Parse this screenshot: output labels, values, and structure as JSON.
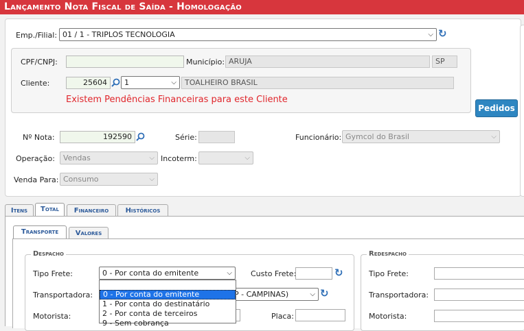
{
  "header": {
    "title": "Lançamento Nota Fiscal de Saída  - Homologação"
  },
  "emp_filial": {
    "label": "Emp./Filial:",
    "value": "01 / 1 - TRIPLOS TECNOLOGIA"
  },
  "cliente_box": {
    "cpf_label": "CPF/CNPJ:",
    "cpf_value": "",
    "municipio_label": "Município:",
    "municipio_value": "ARUJA",
    "uf_value": "SP",
    "cliente_label": "Cliente:",
    "cliente_code": "25604",
    "cliente_seq": "1",
    "cliente_name": "TOALHEIRO BRASIL",
    "warning": "Existem Pendências Financeiras para este Cliente"
  },
  "pedidos_button": "Pedidos",
  "nota": {
    "nota_label": "Nº Nota:",
    "nota_value": "192590",
    "serie_label": "Série:",
    "serie_value": "",
    "funcionario_label": "Funcionário:",
    "funcionario_value": "Gymcol do Brasil",
    "operacao_label": "Operação:",
    "operacao_value": "Vendas",
    "incoterm_label": "Incoterm:",
    "incoterm_value": "",
    "venda_label": "Venda Para:",
    "venda_value": "Consumo"
  },
  "tabs": [
    "Itens",
    "Total",
    "Financeiro",
    "Históricos"
  ],
  "subtabs": [
    "Transporte",
    "Valores"
  ],
  "despacho": {
    "legend": "Despacho",
    "tipo_frete_label": "Tipo Frete:",
    "tipo_frete_value": "0 - Por conta do emitente",
    "custo_frete_label": "Custo Frete:",
    "custo_frete_value": "",
    "transportadora_label": "Transportadora:",
    "transportadora_value": "P - CAMPINAS)",
    "motorista_label": "Motorista:",
    "placa_label": "Placa:",
    "placa_value": ""
  },
  "redespacho": {
    "legend": "Redespacho",
    "tipo_frete_label": "Tipo Frete:",
    "transportadora_label": "Transportadora:",
    "motorista_label": "Motorista:"
  },
  "frete_options": [
    "0 - Por conta do emitente",
    "1 - Por conta do destinatário",
    "2 - Por conta de terceiros",
    "9 - Sem cobrança"
  ],
  "colors": {
    "title_bar": "#d7363d",
    "warning": "#e0262c",
    "accent": "#2e86c1",
    "selected_option": "#1e73e8"
  }
}
